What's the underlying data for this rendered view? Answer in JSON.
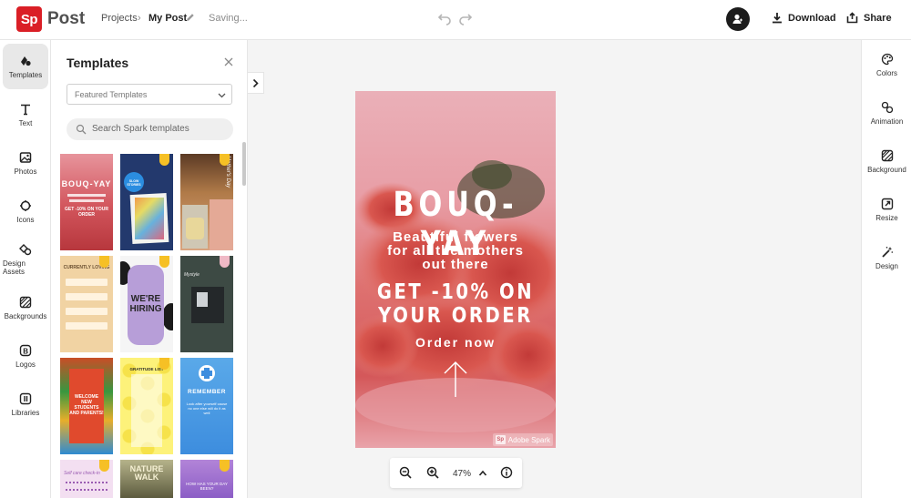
{
  "topbar": {
    "logo_text": "Sp",
    "app_name": "Post",
    "breadcrumb_root": "Projects",
    "breadcrumb_sep": "›",
    "breadcrumb_current": "My Post",
    "status": "Saving...",
    "download_label": "Download",
    "share_label": "Share"
  },
  "left_rail": {
    "items": [
      {
        "label": "Templates",
        "icon": "templates-icon",
        "active": true
      },
      {
        "label": "Text",
        "icon": "text-icon"
      },
      {
        "label": "Photos",
        "icon": "photos-icon"
      },
      {
        "label": "Icons",
        "icon": "icons-icon"
      },
      {
        "label": "Design Assets",
        "icon": "design-assets-icon"
      },
      {
        "label": "Backgrounds",
        "icon": "backgrounds-icon"
      },
      {
        "label": "Logos",
        "icon": "logos-icon"
      },
      {
        "label": "Libraries",
        "icon": "libraries-icon"
      }
    ]
  },
  "panel": {
    "title": "Templates",
    "filter_value": "Featured Templates",
    "search_placeholder": "Search Spark templates",
    "tiles": [
      {
        "name": "bouq-yay",
        "title": "BOUQ-YAY",
        "sub": "GET -10% ON YOUR ORDER",
        "premium": false
      },
      {
        "name": "slow-stories",
        "title": "SLOW STORIES",
        "premium": true
      },
      {
        "name": "mothers-day",
        "title": "Mother's Day",
        "premium": true
      },
      {
        "name": "currently-loving",
        "title": "CURRENTLY LOVING",
        "premium": true
      },
      {
        "name": "we-are-hiring",
        "title": "WE'RE HIRING",
        "premium": true
      },
      {
        "name": "mystyle",
        "title": "Mystyle",
        "premium": true
      },
      {
        "name": "welcome-students",
        "title": "WELCOME NEW STUDENTS AND PARENTS!",
        "premium": false
      },
      {
        "name": "gratitude-list",
        "title": "GRATITUDE LIST",
        "premium": true
      },
      {
        "name": "remember",
        "title": "REMEMBER",
        "sub": "Look after yourself cause no one else will do it as well",
        "premium": false
      },
      {
        "name": "self-care-checklist",
        "title": "Self care check-in",
        "premium": true
      },
      {
        "name": "nature-walk",
        "title": "NATURE WALK",
        "premium": false
      },
      {
        "name": "how-has-your-day-been",
        "title": "HOW HAS YOUR DAY BEEN?",
        "premium": true
      }
    ]
  },
  "poster": {
    "headline": "BOUQ-YAY",
    "sub_lines": [
      "Beautiful flowers",
      "for all the mothers",
      "out there"
    ],
    "offer_lines": [
      "GET -10% ON",
      "YOUR ORDER"
    ],
    "cta": "Order now",
    "watermark_logo": "Sp",
    "watermark_text": "Adobe Spark"
  },
  "zoom": {
    "value": "47%"
  },
  "right_rail": {
    "items": [
      {
        "label": "Colors",
        "icon": "colors-icon"
      },
      {
        "label": "Animation",
        "icon": "animation-icon"
      },
      {
        "label": "Background",
        "icon": "background-icon"
      },
      {
        "label": "Resize",
        "icon": "resize-icon"
      },
      {
        "label": "Design",
        "icon": "design-icon"
      }
    ]
  },
  "colors": {
    "brand": "#da1f26",
    "premium_badge": "#f6c025"
  }
}
